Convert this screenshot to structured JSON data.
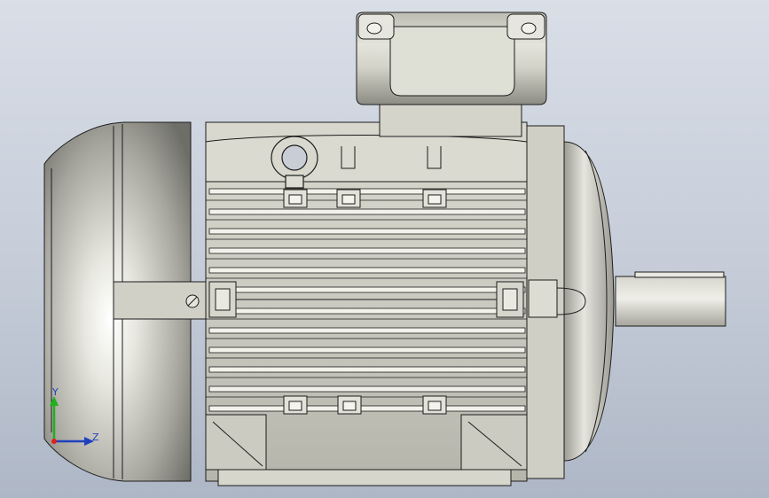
{
  "viewport": {
    "background_top": "#d9dee7",
    "background_bottom": "#aeb7c6",
    "model": "electric-motor",
    "material_color": "#c9c9c1",
    "edge_color": "#1c1c1c"
  },
  "triad": {
    "y_label": "Y",
    "z_label": "Z",
    "x_color": "#e02020",
    "y_color": "#20b020",
    "z_color": "#1f3fbf"
  }
}
